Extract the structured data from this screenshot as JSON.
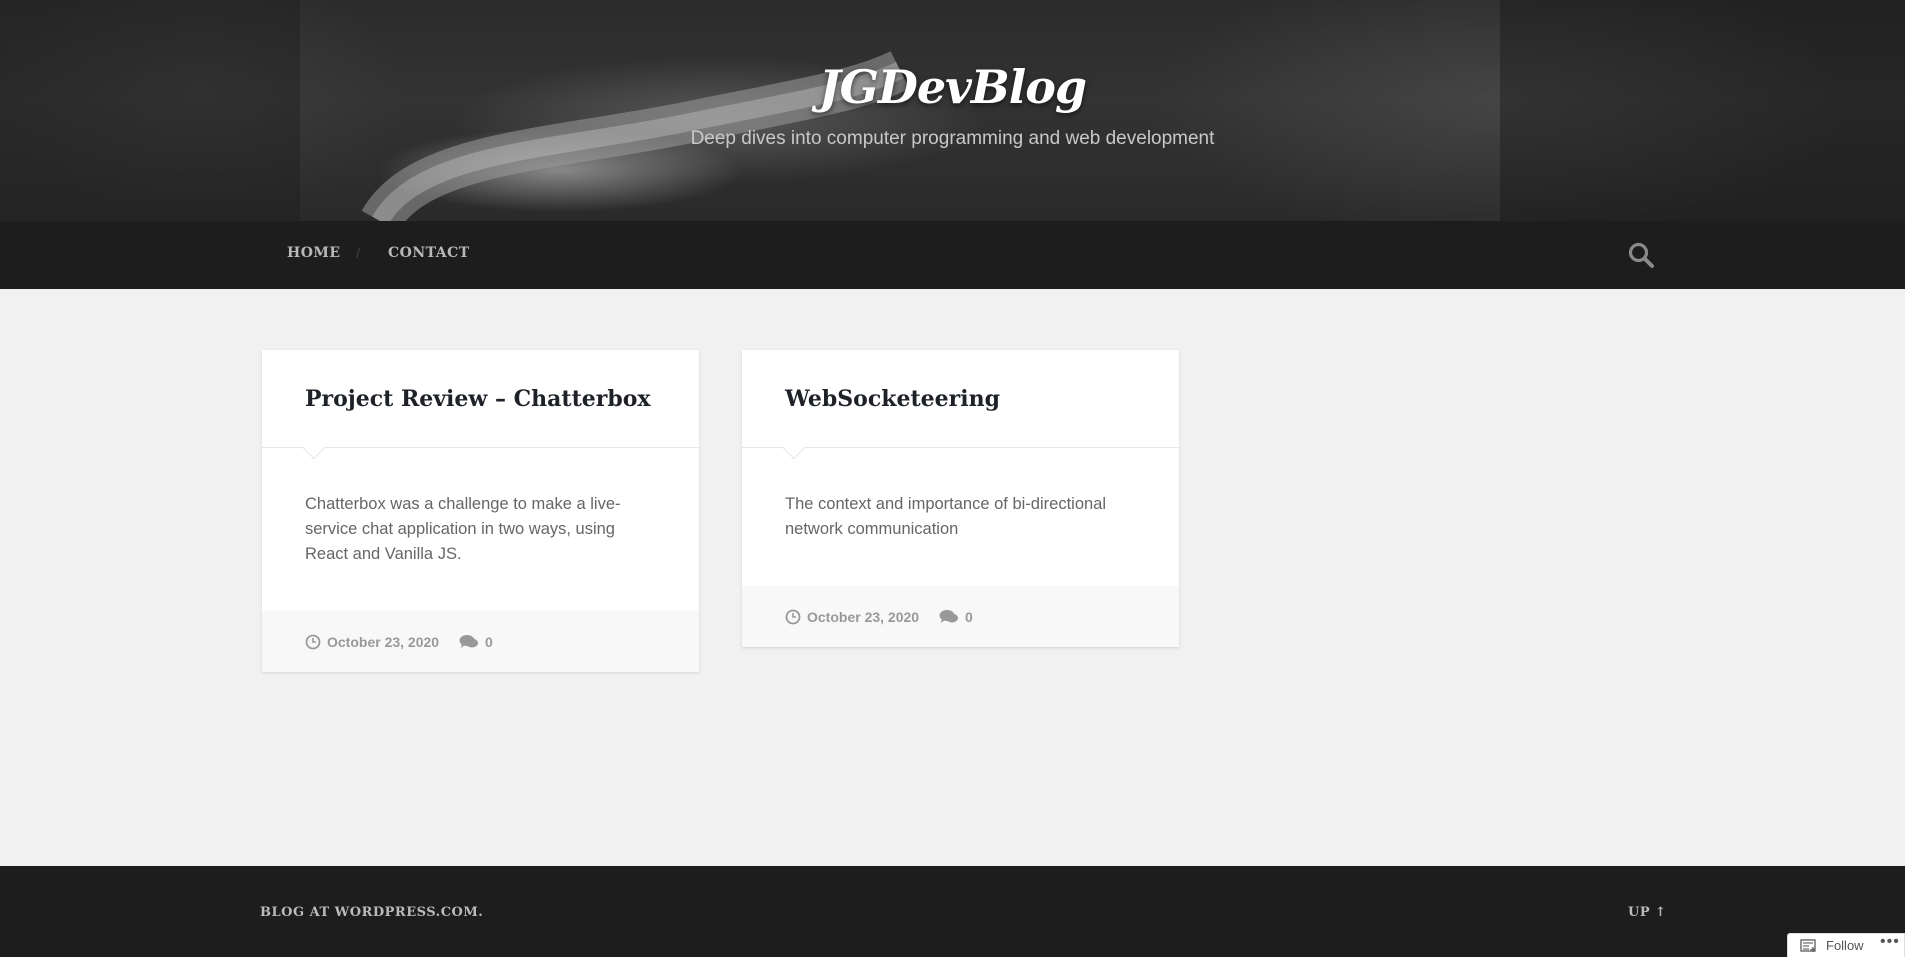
{
  "header": {
    "title": "JGDevBlog",
    "description": "Deep dives into computer programming and web development"
  },
  "nav": {
    "items": [
      {
        "label": "HOME"
      },
      {
        "label": "CONTACT"
      }
    ],
    "separator": "/"
  },
  "posts": [
    {
      "title": "Project Review – Chatterbox",
      "excerpt": "Chatterbox was a challenge to make a live-service chat application in two ways, using React and Vanilla JS.",
      "date": "October 23, 2020",
      "comments": "0"
    },
    {
      "title": "WebSocketeering",
      "excerpt": "The context and importance of bi-directional network communication",
      "date": "October 23, 2020",
      "comments": "0"
    }
  ],
  "footer": {
    "credit": "BLOG AT WORDPRESS.COM.",
    "up": "UP ↑"
  },
  "follow": {
    "label": "Follow",
    "more": "•••"
  },
  "colors": {
    "nav_bg": "#1d1d1d",
    "page_bg": "#f1f1f1",
    "title_color": "#1e2228"
  }
}
